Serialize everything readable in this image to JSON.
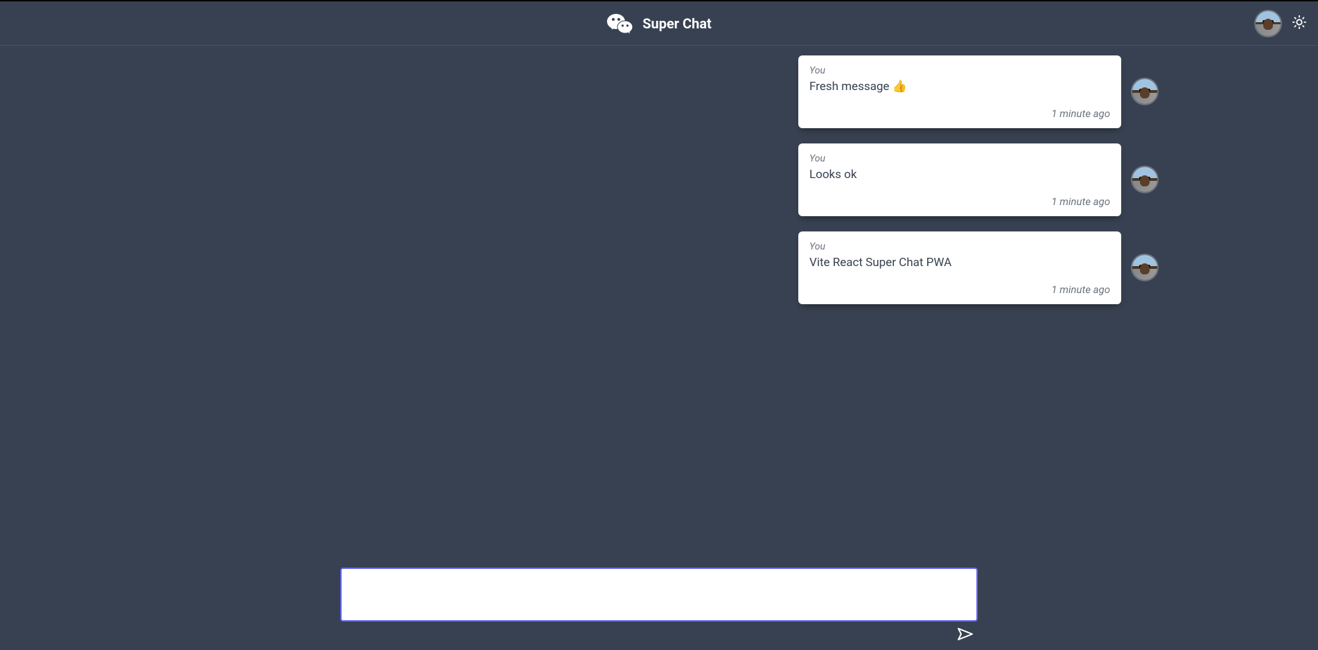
{
  "header": {
    "title": "Super Chat"
  },
  "messages": [
    {
      "sender": "You",
      "text": "Fresh message 👍",
      "time": "1 minute ago"
    },
    {
      "sender": "You",
      "text": "Looks ok",
      "time": "1 minute ago"
    },
    {
      "sender": "You",
      "text": "Vite React Super Chat PWA",
      "time": "1 minute ago"
    }
  ],
  "composer": {
    "value": "",
    "placeholder": ""
  }
}
